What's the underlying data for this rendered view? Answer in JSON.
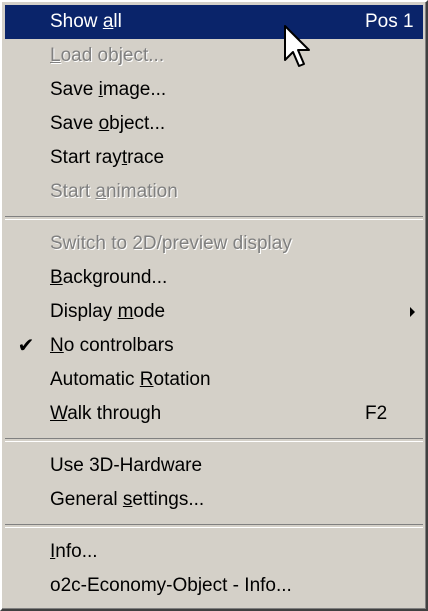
{
  "menu": {
    "groups": [
      [
        {
          "prefix": "Show ",
          "mnemonic": "a",
          "suffix": "ll",
          "shortcut": "Pos 1",
          "highlighted": true,
          "enabled": true
        },
        {
          "prefix": "",
          "mnemonic": "L",
          "suffix": "oad object...",
          "enabled": false
        },
        {
          "prefix": "Save ",
          "mnemonic": "i",
          "suffix": "mage...",
          "enabled": true
        },
        {
          "prefix": "Save ",
          "mnemonic": "o",
          "suffix": "bject...",
          "enabled": true
        },
        {
          "prefix": "Start ray",
          "mnemonic": "t",
          "suffix": "race",
          "enabled": true
        },
        {
          "prefix": "Start ",
          "mnemonic": "a",
          "suffix": "nimation",
          "enabled": false
        }
      ],
      [
        {
          "prefix": "Switch to 2D/preview display",
          "mnemonic": "",
          "suffix": "",
          "enabled": false
        },
        {
          "prefix": "",
          "mnemonic": "B",
          "suffix": "ackground...",
          "enabled": true
        },
        {
          "prefix": "Display ",
          "mnemonic": "m",
          "suffix": "ode",
          "enabled": true,
          "submenu": true
        },
        {
          "prefix": "",
          "mnemonic": "N",
          "suffix": "o controlbars",
          "enabled": true,
          "checked": true
        },
        {
          "prefix": "Automatic ",
          "mnemonic": "R",
          "suffix": "otation",
          "enabled": true
        },
        {
          "prefix": "",
          "mnemonic": "W",
          "suffix": "alk through",
          "shortcut": "F2",
          "enabled": true
        }
      ],
      [
        {
          "prefix": "Use 3D-Hardware",
          "mnemonic": "",
          "suffix": "",
          "enabled": true
        },
        {
          "prefix": "General ",
          "mnemonic": "s",
          "suffix": "ettings...",
          "enabled": true
        }
      ],
      [
        {
          "prefix": "",
          "mnemonic": "I",
          "suffix": "nfo...",
          "enabled": true
        },
        {
          "prefix": "o2c-Economy-Object - Info...",
          "mnemonic": "",
          "suffix": "",
          "enabled": true
        }
      ]
    ],
    "check_icon": "checkmark-icon",
    "submenu_icon": "submenu-arrow-icon",
    "cursor_icon": "mouse-pointer-icon",
    "colors": {
      "highlight": "#0a246a",
      "disabled": "#808080",
      "background": "#d4d0c8"
    }
  }
}
